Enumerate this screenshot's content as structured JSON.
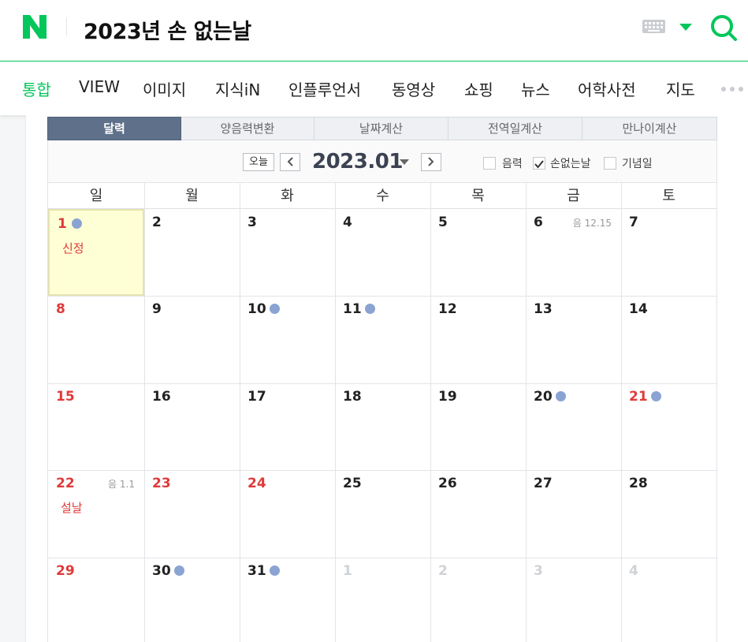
{
  "search": {
    "query": "2023년 손 없는날"
  },
  "nav_tabs": [
    "통합",
    "VIEW",
    "이미지",
    "지식iN",
    "인플루언서",
    "동영상",
    "쇼핑",
    "뉴스",
    "어학사전",
    "지도"
  ],
  "calendar": {
    "tabs": [
      "달력",
      "양음력변환",
      "날짜계산",
      "전역일계산",
      "만나이계산"
    ],
    "today_label": "오늘",
    "month_label": "2023.01",
    "filters": [
      {
        "label": "음력",
        "checked": false
      },
      {
        "label": "손없는날",
        "checked": true
      },
      {
        "label": "기념일",
        "checked": false
      }
    ],
    "weekdays": [
      "일",
      "월",
      "화",
      "수",
      "목",
      "금",
      "토"
    ],
    "weeks": [
      [
        {
          "day": "1",
          "red": true,
          "dot": true,
          "holiday": "신정",
          "today": true
        },
        {
          "day": "2"
        },
        {
          "day": "3"
        },
        {
          "day": "4"
        },
        {
          "day": "5"
        },
        {
          "day": "6",
          "lunar": "음 12.15"
        },
        {
          "day": "7"
        }
      ],
      [
        {
          "day": "8",
          "red": true
        },
        {
          "day": "9"
        },
        {
          "day": "10",
          "dot": true
        },
        {
          "day": "11",
          "dot": true
        },
        {
          "day": "12"
        },
        {
          "day": "13"
        },
        {
          "day": "14"
        }
      ],
      [
        {
          "day": "15",
          "red": true
        },
        {
          "day": "16"
        },
        {
          "day": "17"
        },
        {
          "day": "18"
        },
        {
          "day": "19"
        },
        {
          "day": "20",
          "dot": true
        },
        {
          "day": "21",
          "red": true,
          "dot": true
        }
      ],
      [
        {
          "day": "22",
          "red": true,
          "lunar": "음 1.1",
          "holiday": "설날"
        },
        {
          "day": "23",
          "red": true
        },
        {
          "day": "24",
          "red": true
        },
        {
          "day": "25"
        },
        {
          "day": "26"
        },
        {
          "day": "27"
        },
        {
          "day": "28"
        }
      ],
      [
        {
          "day": "29",
          "red": true
        },
        {
          "day": "30",
          "dot": true
        },
        {
          "day": "31",
          "dot": true
        },
        {
          "day": "1",
          "other": true
        },
        {
          "day": "2",
          "other": true
        },
        {
          "day": "3",
          "other": true
        },
        {
          "day": "4",
          "other": true
        }
      ]
    ]
  },
  "colors": {
    "brand": "#03c75a",
    "holiday": "#e03a3a",
    "dot": "#8aa3d3",
    "today_bg": "#ffffd6"
  }
}
